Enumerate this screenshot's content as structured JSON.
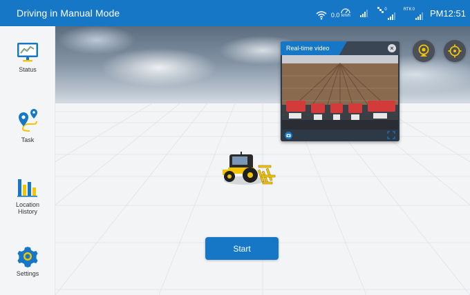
{
  "header": {
    "title": "Driving in Manual Mode",
    "speed_value": "0.0",
    "speed_unit": "km/h",
    "satellite_count": "0",
    "rtk_label": "RTK",
    "rtk_status": "0",
    "clock": "PM12:51"
  },
  "sidebar": {
    "items": [
      {
        "label": "Status",
        "icon": "monitor-chart-icon"
      },
      {
        "label": "Task",
        "icon": "route-pin-icon"
      },
      {
        "label": "Location History",
        "label_line1": "Location",
        "label_line2": "History",
        "icon": "bar-chart-icon"
      },
      {
        "label": "Settings",
        "icon": "gear-icon"
      }
    ]
  },
  "video_panel": {
    "title": "Real-time video",
    "close_icon": "close-icon",
    "camera_icon": "camera-icon",
    "fullscreen_icon": "expand-icon"
  },
  "controls": {
    "camera_button_icon": "webcam-icon",
    "locate_button_icon": "crosshair-icon",
    "start_label": "Start"
  },
  "colors": {
    "primary": "#1677c7",
    "accent_yellow": "#f5c400",
    "button_dark": "#4a4f58"
  }
}
